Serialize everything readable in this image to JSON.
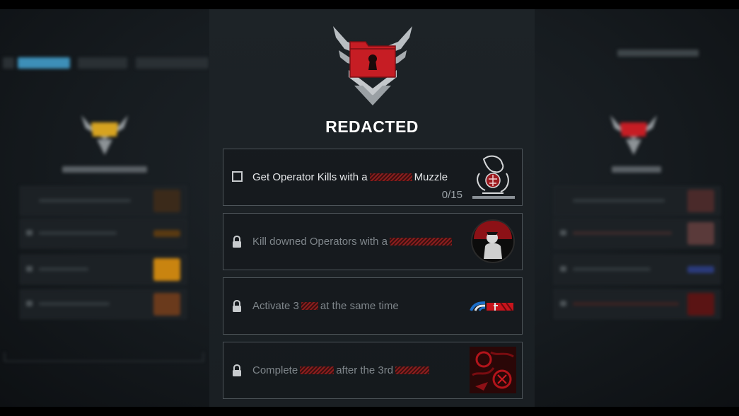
{
  "page": {
    "title": "REDACTED",
    "colors": {
      "accent_red": "#c61d24",
      "text_primary": "#ffffff",
      "text_locked": "#7f868b",
      "bg_tab_active": "#3d8fb8"
    }
  },
  "emblem": {
    "icon": "locked-folder-winged-chevron-icon"
  },
  "challenges": [
    {
      "state": "active",
      "text_before": "Get Operator Kills with a",
      "text_after": "Muzzle",
      "progress": "0/15",
      "progress_current": 0,
      "progress_total": 15,
      "reward_icon": "skull-dragon-sticker-icon"
    },
    {
      "state": "locked",
      "text_before": "Kill downed Operators with a",
      "text_after": "",
      "reward_icon": "operator-portrait-calling-card-icon"
    },
    {
      "state": "locked",
      "text_before": "Activate 3",
      "text_after": "at the same time",
      "reward_icon": "blue-red-emblem-stripe-icon"
    },
    {
      "state": "locked",
      "text_before": "Complete",
      "text_middle": "after the 3rd",
      "reward_icon": "red-graffiti-calling-card-icon"
    }
  ]
}
